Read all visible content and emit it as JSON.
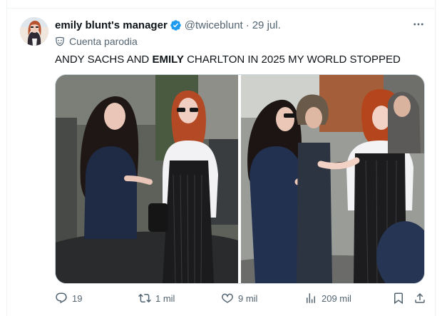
{
  "tweet": {
    "author": {
      "display_name": "emily blunt's manager",
      "handle": "@twiceblunt",
      "date": "29 jul.",
      "verified": true
    },
    "label": "Cuenta parodia",
    "text_parts": [
      {
        "text": "ANDY SACHS AND ",
        "bold": false
      },
      {
        "text": "EMILY",
        "bold": true
      },
      {
        "text": " CHARLTON IN 2025 MY WORLD STOPPED",
        "bold": false
      }
    ],
    "actions": {
      "replies": "19",
      "reposts": "1 mil",
      "likes": "9 mil",
      "views": "209 mil"
    }
  },
  "icons": {
    "more": "more-horizontal-icon",
    "verified": "verified-badge-icon",
    "parody": "parody-mask-icon",
    "reply": "reply-icon",
    "repost": "repost-icon",
    "like": "heart-icon",
    "views": "views-chart-icon",
    "bookmark": "bookmark-icon",
    "share": "share-icon"
  },
  "colors": {
    "accent": "#1d9bf0",
    "text": "#0f1419",
    "secondary": "#536471",
    "border": "#eff3f4"
  }
}
